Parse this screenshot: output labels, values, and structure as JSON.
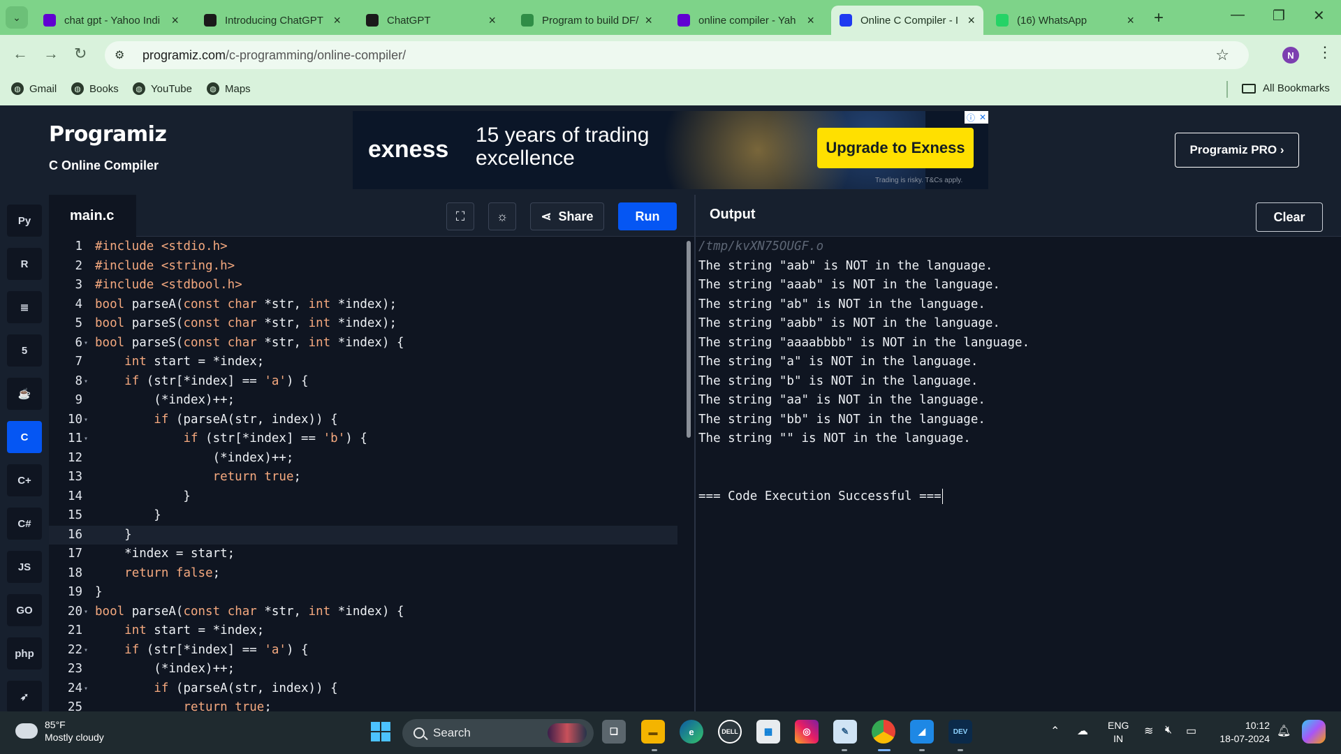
{
  "browser": {
    "tabs": [
      {
        "title": "chat gpt - Yahoo Indi",
        "favicon": "yahoo-icon",
        "color": "#6001d2"
      },
      {
        "title": "Introducing ChatGPT",
        "favicon": "openai-icon",
        "color": "#1a1a1a"
      },
      {
        "title": "ChatGPT",
        "favicon": "openai-icon",
        "color": "#1a1a1a"
      },
      {
        "title": "Program to build DF/",
        "favicon": "gfg-icon",
        "color": "#2f8d46"
      },
      {
        "title": "online compiler - Yah",
        "favicon": "yahoo-icon",
        "color": "#6001d2"
      },
      {
        "title": "Online C Compiler - I",
        "favicon": "programiz-icon",
        "color": "#1d3af0"
      },
      {
        "title": "(16) WhatsApp",
        "favicon": "whatsapp-icon",
        "color": "#25d366"
      }
    ],
    "active_tab_index": 5,
    "url_host": "programiz.com",
    "url_path": "/c-programming/online-compiler/",
    "profile_initial": "N",
    "bookmarks": [
      "Gmail",
      "Books",
      "YouTube",
      "Maps"
    ],
    "all_bookmarks_label": "All Bookmarks"
  },
  "site": {
    "logo": "Programiz",
    "subtitle": "C Online Compiler",
    "pro_button": "Programiz PRO ›",
    "ad": {
      "brand": "exness",
      "headline": "15 years of trading excellence",
      "cta": "Upgrade to Exness",
      "disclaimer": "Trading is risky. T&Cs apply."
    }
  },
  "languages": [
    {
      "name": "python-icon",
      "glyph": "Py"
    },
    {
      "name": "r-icon",
      "glyph": "R"
    },
    {
      "name": "sql-icon",
      "glyph": "≣"
    },
    {
      "name": "html-icon",
      "glyph": "5"
    },
    {
      "name": "java-icon",
      "glyph": "☕"
    },
    {
      "name": "c-icon",
      "glyph": "C",
      "active": true
    },
    {
      "name": "cpp-icon",
      "glyph": "C+"
    },
    {
      "name": "csharp-icon",
      "glyph": "C#"
    },
    {
      "name": "js-icon",
      "glyph": "JS"
    },
    {
      "name": "go-icon",
      "glyph": "GO"
    },
    {
      "name": "php-icon",
      "glyph": "php"
    },
    {
      "name": "swift-icon",
      "glyph": "➶"
    }
  ],
  "editor": {
    "filename": "main.c",
    "share_label": "Share",
    "run_label": "Run",
    "highlighted_line": 16,
    "lines": [
      "#include <stdio.h>",
      "#include <string.h>",
      "#include <stdbool.h>",
      "bool parseA(const char *str, int *index);",
      "bool parseS(const char *str, int *index);",
      "bool parseS(const char *str, int *index) {",
      "    int start = *index;",
      "    if (str[*index] == 'a') {",
      "        (*index)++;",
      "        if (parseA(str, index)) {",
      "            if (str[*index] == 'b') {",
      "                (*index)++;",
      "                return true;",
      "            }",
      "        }",
      "    }",
      "    *index = start;",
      "    return false;",
      "}",
      "bool parseA(const char *str, int *index) {",
      "    int start = *index;",
      "    if (str[*index] == 'a') {",
      "        (*index)++;",
      "        if (parseA(str, index)) {",
      "            return true;"
    ],
    "fold_lines": [
      6,
      8,
      10,
      11,
      20,
      22,
      24
    ]
  },
  "output": {
    "title": "Output",
    "clear_label": "Clear",
    "path": "/tmp/kvXN75OUGF.o",
    "lines": [
      "The string \"aab\" is NOT in the language.",
      "The string \"aaab\" is NOT in the language.",
      "The string \"ab\" is NOT in the language.",
      "The string \"aabb\" is NOT in the language.",
      "The string \"aaaabbbb\" is NOT in the language.",
      "The string \"a\" is NOT in the language.",
      "The string \"b\" is NOT in the language.",
      "The string \"aa\" is NOT in the language.",
      "The string \"bb\" is NOT in the language.",
      "The string \"\" is NOT in the language."
    ],
    "status": "=== Code Execution Successful ==="
  },
  "taskbar": {
    "weather_temp": "85°F",
    "weather_desc": "Mostly cloudy",
    "search_label": "Search",
    "lang_top": "ENG",
    "lang_bottom": "IN",
    "time": "10:12",
    "date": "18-07-2024"
  },
  "colors": {
    "accent": "#0556f3",
    "bg": "#0f1521",
    "panel": "#17202e",
    "keyword": "#f5a97f",
    "string": "#f5a97f",
    "preprocessor": "#f5a97f"
  }
}
